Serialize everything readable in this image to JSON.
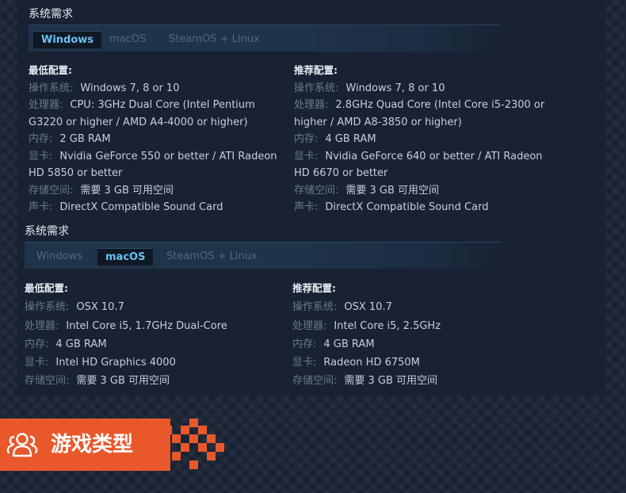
{
  "sections": [
    {
      "title": "系统需求",
      "tabs": [
        "Windows",
        "macOS",
        "SteamOS + Linux"
      ],
      "active_tab": "Windows",
      "minimum": {
        "heading": "最低配置:",
        "rows": [
          {
            "label": "操作系统:",
            "value": "Windows 7, 8 or 10"
          },
          {
            "label": "处理器:",
            "value": "CPU: 3GHz Dual Core (Intel Pentium G3220 or higher / AMD A4-4000 or higher)"
          },
          {
            "label": "内存:",
            "value": "2 GB RAM"
          },
          {
            "label": "显卡:",
            "value": "Nvidia GeForce 550 or better / ATI Radeon HD 5850 or better"
          },
          {
            "label": "存储空间:",
            "value": "需要 3 GB 可用空间"
          },
          {
            "label": "声卡:",
            "value": "DirectX Compatible Sound Card"
          }
        ]
      },
      "recommended": {
        "heading": "推荐配置:",
        "rows": [
          {
            "label": "操作系统:",
            "value": "Windows 7, 8 or 10"
          },
          {
            "label": "处理器:",
            "value": "2.8GHz Quad Core (Intel Core i5-2300 or higher / AMD A8-3850 or higher)"
          },
          {
            "label": "内存:",
            "value": "4 GB RAM"
          },
          {
            "label": "显卡:",
            "value": "Nvidia GeForce 640 or better / ATI Radeon HD 6670 or better"
          },
          {
            "label": "存储空间:",
            "value": "需要 3 GB 可用空间"
          },
          {
            "label": "声卡:",
            "value": "DirectX Compatible Sound Card"
          }
        ]
      }
    },
    {
      "title": "系统需求",
      "tabs": [
        "Windows",
        "macOS",
        "SteamOS + Linux"
      ],
      "active_tab": "macOS",
      "minimum": {
        "heading": "最低配置:",
        "rows": [
          {
            "label": "操作系统:",
            "value": "OSX 10.7"
          },
          {
            "label": "处理器:",
            "value": "Intel Core i5, 1.7GHz Dual-Core"
          },
          {
            "label": "内存:",
            "value": "4 GB RAM"
          },
          {
            "label": "显卡:",
            "value": "Intel HD Graphics 4000"
          },
          {
            "label": "存储空间:",
            "value": "需要 3 GB 可用空间"
          }
        ]
      },
      "recommended": {
        "heading": "推荐配置:",
        "rows": [
          {
            "label": "操作系统:",
            "value": "OSX 10.7"
          },
          {
            "label": "处理器:",
            "value": "Intel Core i5, 2.5GHz"
          },
          {
            "label": "内存:",
            "value": "4 GB RAM"
          },
          {
            "label": "显卡:",
            "value": "Radeon HD 6750M"
          },
          {
            "label": "存储空间:",
            "value": "需要 3 GB 可用空间"
          }
        ]
      }
    }
  ],
  "banner": {
    "title": "游戏类型",
    "icon": "people-icon",
    "color": "#e8582a"
  },
  "colors": {
    "active_tab_text": "#67c1f5",
    "inactive_tab_text": "#4f6a85",
    "label_text": "#6b7a88",
    "value_text": "#c6d0da"
  }
}
